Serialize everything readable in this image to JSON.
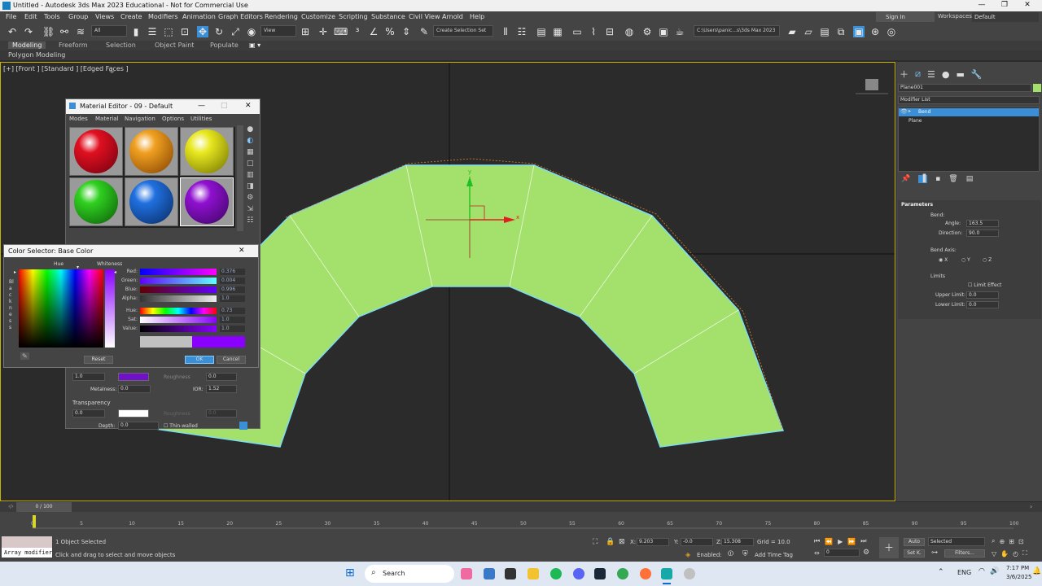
{
  "app": {
    "title": "Untitled - Autodesk 3ds Max 2023 Educational - Not for Commercial Use"
  },
  "menu": [
    "File",
    "Edit",
    "Tools",
    "Group",
    "Views",
    "Create",
    "Modifiers",
    "Animation",
    "Graph Editors",
    "Rendering",
    "Customize",
    "Scripting",
    "Substance",
    "Civil View",
    "Arnold",
    "Help"
  ],
  "account": {
    "sign_in": "Sign In",
    "workspaces_label": "Workspaces:",
    "workspace": "Default"
  },
  "toolbar": {
    "filter": "All",
    "view": "View",
    "selection_set": "Create Selection Set",
    "path": "C:\\Users\\panic...s\\3ds Max 2023"
  },
  "ribbon": {
    "tabs": [
      "Modeling",
      "Freeform",
      "Selection",
      "Object Paint",
      "Populate"
    ],
    "sub": "Polygon Modeling"
  },
  "viewport": {
    "label": "[+] [Front ] [Standard ] [Edged Faces ]",
    "axis_y": "y",
    "axis_x": "x"
  },
  "right_panel": {
    "object_name": "Plane001",
    "modifier_list": "Modifier List",
    "stack": [
      "Bend",
      "Plane"
    ],
    "parameters_title": "Parameters",
    "bend_label": "Bend:",
    "angle_label": "Angle:",
    "angle": "163.5",
    "direction_label": "Direction:",
    "direction": "90.0",
    "bend_axis_label": "Bend Axis:",
    "axes": [
      "X",
      "Y",
      "Z"
    ],
    "limits_label": "Limits",
    "limit_effect": "Limit Effect",
    "upper_label": "Upper Limit:",
    "upper": "0.0",
    "lower_label": "Lower Limit:",
    "lower": "0.0"
  },
  "material_editor": {
    "title": "Material Editor - 09 - Default",
    "menu": [
      "Modes",
      "Material",
      "Navigation",
      "Options",
      "Utilities"
    ],
    "spheres": [
      "#e01020",
      "#f0a020",
      "#e8e820",
      "#30d020",
      "#2070e0",
      "#9010d0"
    ],
    "row1_val": "1.0",
    "roughness": "Roughness",
    "roughness_val": "0.0",
    "metalness_label": "Metalness:",
    "metalness": "0.0",
    "ior_label": "IOR:",
    "ior": "1.52",
    "transparency": "Transparency",
    "trans_val": "0.0",
    "roughness2": "Roughness",
    "trans_rough_val": "0.0",
    "depth_label": "Depth:",
    "depth": "0.0",
    "thin_walled": "Thin-walled"
  },
  "color_selector": {
    "title": "Color Selector: Base Color",
    "hue": "Hue",
    "whiteness": "Whiteness",
    "blackness": "Blackness",
    "red_label": "Red:",
    "red": "0.376",
    "green_label": "Green:",
    "green": "0.004",
    "blue_label": "Blue:",
    "blue": "0.996",
    "alpha_label": "Alpha:",
    "alpha": "1.0",
    "hue_label": "Hue:",
    "hue_val": "0.73",
    "sat_label": "Sat:",
    "sat": "1.0",
    "value_label": "Value:",
    "value": "1.0",
    "reset": "Reset",
    "ok": "OK",
    "cancel": "Cancel"
  },
  "timeline": {
    "frame": "0 / 100",
    "ticks": [
      "0",
      "5",
      "10",
      "15",
      "20",
      "25",
      "30",
      "35",
      "40",
      "45",
      "50",
      "55",
      "60",
      "65",
      "70",
      "75",
      "80",
      "85",
      "90",
      "95",
      "100"
    ]
  },
  "status": {
    "script_label": "Array modifier",
    "selected": "1 Object Selected",
    "hint": "Click and drag to select and move objects",
    "x_label": "X:",
    "x": "9.203",
    "y_label": "Y:",
    "y": "-0.0",
    "z_label": "Z:",
    "z": "15.308",
    "grid": "Grid = 10.0",
    "enabled": "Enabled:",
    "add_time_tag": "Add Time Tag",
    "auto": "Auto",
    "selected_dd": "Selected",
    "setk": "Set K.",
    "filters": "Filters...",
    "frame_field": "0"
  },
  "taskbar": {
    "search": "Search",
    "lang": "ENG",
    "time": "7:17 PM",
    "date": "3/6/2025"
  },
  "colors": {
    "accent": "#3a8fd6",
    "mesh": "#a4e06c",
    "viewport_border": "#c8b400"
  }
}
